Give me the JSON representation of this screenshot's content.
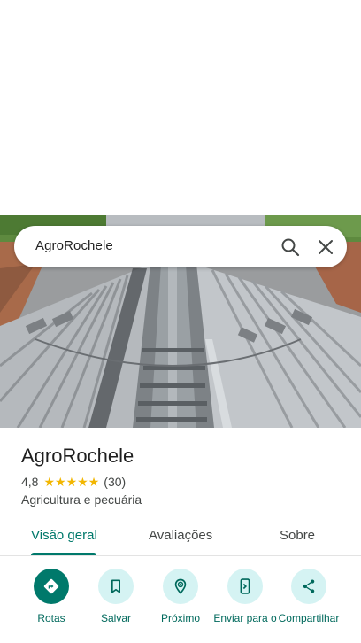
{
  "search": {
    "query": "AgroRochele"
  },
  "place": {
    "name": "AgroRochele",
    "rating": "4,8",
    "stars": [
      "★",
      "★",
      "★",
      "★",
      "★"
    ],
    "review_count": "(30)",
    "category": "Agricultura e pecuária"
  },
  "tabs": [
    {
      "label": "Visão geral",
      "active": true
    },
    {
      "label": "Avaliações",
      "active": false
    },
    {
      "label": "Sobre",
      "active": false
    }
  ],
  "actions": [
    {
      "label": "Rotas",
      "icon": "directions-icon"
    },
    {
      "label": "Salvar",
      "icon": "bookmark-icon"
    },
    {
      "label": "Próximo",
      "icon": "nearby-icon"
    },
    {
      "label": "Enviar para o",
      "icon": "send-to-phone-icon"
    },
    {
      "label": "Compartilhar",
      "icon": "share-icon"
    }
  ],
  "colors": {
    "accent": "#00796b",
    "action_bg": "#d5f3f3",
    "star": "#f2b600"
  }
}
